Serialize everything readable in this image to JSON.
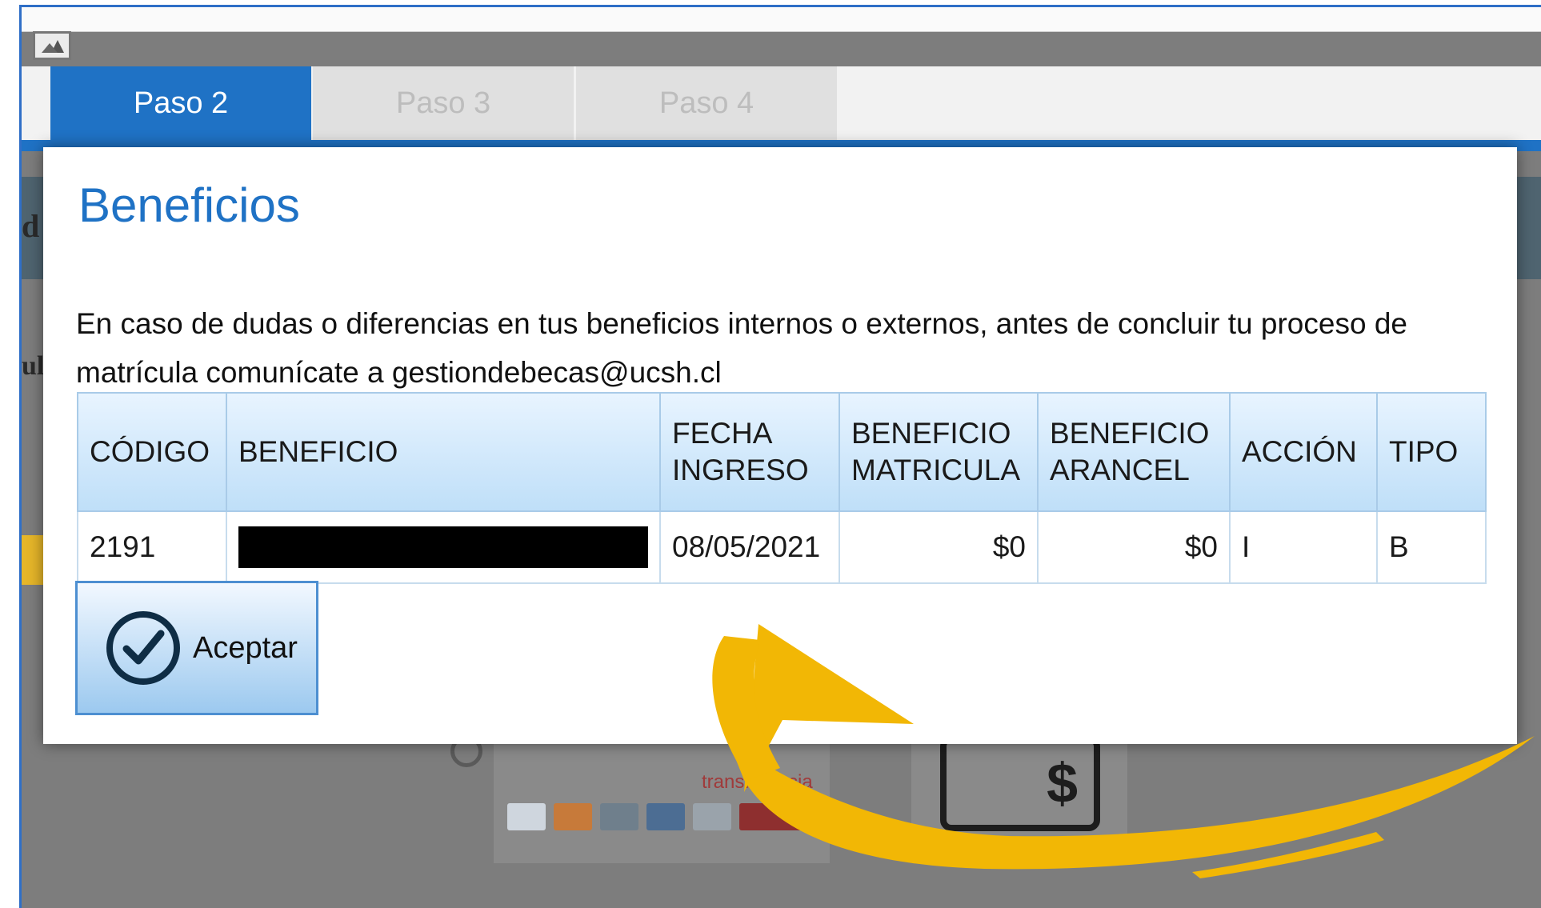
{
  "tabs": [
    {
      "label": "Paso 2",
      "active": true
    },
    {
      "label": "Paso 3",
      "active": false
    },
    {
      "label": "Paso 4",
      "active": false
    }
  ],
  "modal": {
    "title": "Beneficios",
    "message": "En caso de dudas o diferencias en tus beneficios internos o externos, antes de concluir tu proceso de matrícula comunícate a gestiondebecas@ucsh.cl",
    "table": {
      "headers": [
        "CÓDIGO",
        "BENEFICIO",
        "FECHA INGRESO",
        "BENEFICIO MATRICULA",
        "BENEFICIO ARANCEL",
        "ACCIÓN",
        "TIPO"
      ],
      "rows": [
        {
          "codigo": "2191",
          "beneficio": "",
          "fecha_ingreso": "08/05/2021",
          "beneficio_matricula": "$0",
          "beneficio_arancel": "$0",
          "accion": "I",
          "tipo": "B"
        }
      ]
    },
    "accept_button": {
      "label": "Aceptar",
      "icon": "check-circle-icon"
    }
  },
  "background": {
    "fragment_a": "d",
    "fragment_b": "ul",
    "payment_caption": "transferencia"
  },
  "colors": {
    "accent_blue": "#1f72c5",
    "annotation_arrow": "#f2b705",
    "overlay_gray": "#7d7d7d"
  }
}
